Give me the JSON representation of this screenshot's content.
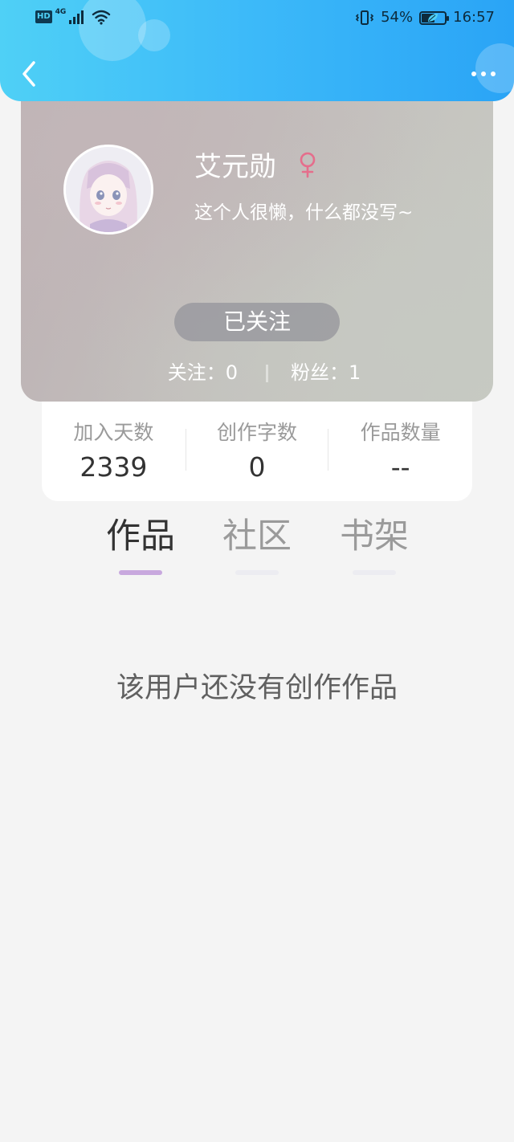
{
  "status_bar": {
    "hd": "HD",
    "network": "4G",
    "battery_percent": "54%",
    "battery_level": 0.54,
    "time": "16:57"
  },
  "header": {
    "back_icon": "chevron-left-icon",
    "more_icon": "more-dots-icon"
  },
  "profile": {
    "name": "艾元勋",
    "gender_icon": "female-icon",
    "gender_color": "#e56e8c",
    "bio": "这个人很懒，什么都没写~",
    "follow_button": "已关注",
    "following_label": "关注：",
    "following_count": "0",
    "fans_label": "粉丝：",
    "fans_count": "1"
  },
  "stats": [
    {
      "label": "加入天数",
      "value": "2339"
    },
    {
      "label": "创作字数",
      "value": "0"
    },
    {
      "label": "作品数量",
      "value": "--"
    }
  ],
  "tabs": [
    {
      "label": "作品",
      "active": true
    },
    {
      "label": "社区",
      "active": false
    },
    {
      "label": "书架",
      "active": false
    }
  ],
  "empty_message": "该用户还没有创作作品",
  "colors": {
    "header_gradient_start": "#4fd0f6",
    "header_gradient_end": "#2aa4f6",
    "active_tab_indicator": "#c8a8de",
    "page_background": "#f4f4f4"
  }
}
